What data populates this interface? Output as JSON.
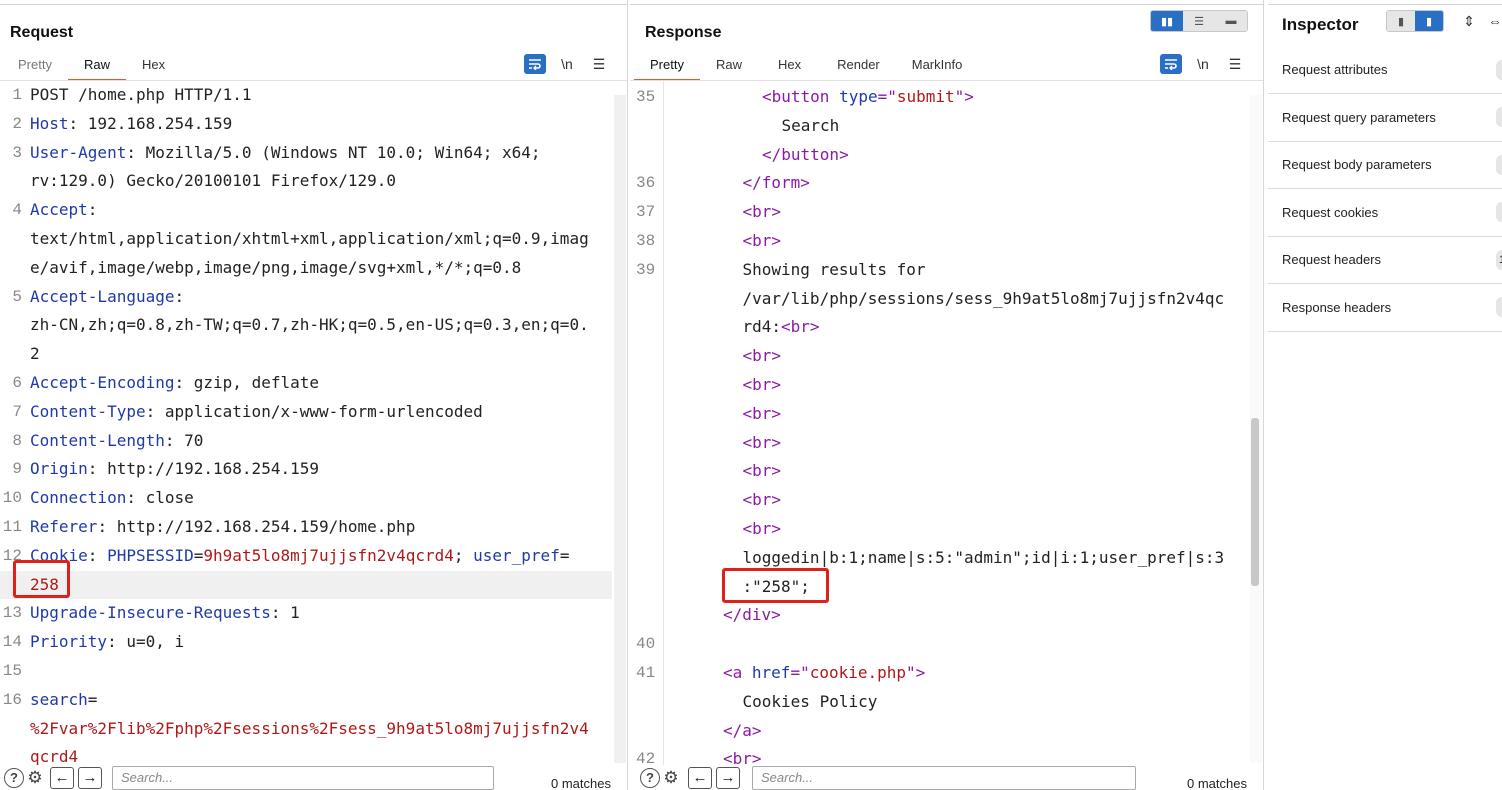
{
  "request": {
    "title": "Request",
    "tabs": [
      "Pretty",
      "Raw",
      "Hex"
    ],
    "active_tab": "Raw",
    "icons": [
      "wrap-lines-icon",
      "newline-toggle-icon",
      "menu-icon"
    ],
    "newline_label": "\\n",
    "lines": [
      {
        "n": "1",
        "segs": [
          [
            "p",
            "POST /home.php HTTP/1.1"
          ]
        ]
      },
      {
        "n": "2",
        "segs": [
          [
            "k",
            "Host"
          ],
          [
            "p",
            ": 192.168.254.159"
          ]
        ]
      },
      {
        "n": "3",
        "segs": [
          [
            "k",
            "User-Agent"
          ],
          [
            "p",
            ": Mozilla/5.0 (Windows NT 10.0; Win64; x64;"
          ]
        ]
      },
      {
        "n": "",
        "segs": [
          [
            "p",
            "rv:129.0) Gecko/20100101 Firefox/129.0"
          ]
        ]
      },
      {
        "n": "4",
        "segs": [
          [
            "k",
            "Accept"
          ],
          [
            "p",
            ":"
          ]
        ]
      },
      {
        "n": "",
        "segs": [
          [
            "p",
            "text/html,application/xhtml+xml,application/xml;q=0.9,imag"
          ]
        ]
      },
      {
        "n": "",
        "segs": [
          [
            "p",
            "e/avif,image/webp,image/png,image/svg+xml,*/*;q=0.8"
          ]
        ]
      },
      {
        "n": "5",
        "segs": [
          [
            "k",
            "Accept-Language"
          ],
          [
            "p",
            ":"
          ]
        ]
      },
      {
        "n": "",
        "segs": [
          [
            "p",
            "zh-CN,zh;q=0.8,zh-TW;q=0.7,zh-HK;q=0.5,en-US;q=0.3,en;q=0."
          ]
        ]
      },
      {
        "n": "",
        "segs": [
          [
            "p",
            "2"
          ]
        ]
      },
      {
        "n": "6",
        "segs": [
          [
            "k",
            "Accept-Encoding"
          ],
          [
            "p",
            ": gzip, deflate"
          ]
        ]
      },
      {
        "n": "7",
        "segs": [
          [
            "k",
            "Content-Type"
          ],
          [
            "p",
            ": application/x-www-form-urlencoded"
          ]
        ]
      },
      {
        "n": "8",
        "segs": [
          [
            "k",
            "Content-Length"
          ],
          [
            "p",
            ": 70"
          ]
        ]
      },
      {
        "n": "9",
        "segs": [
          [
            "k",
            "Origin"
          ],
          [
            "p",
            ": http://192.168.254.159"
          ]
        ]
      },
      {
        "n": "10",
        "segs": [
          [
            "k",
            "Connection"
          ],
          [
            "p",
            ": close"
          ]
        ]
      },
      {
        "n": "11",
        "segs": [
          [
            "k",
            "Referer"
          ],
          [
            "p",
            ": http://192.168.254.159/home.php"
          ]
        ]
      },
      {
        "n": "12",
        "segs": [
          [
            "k",
            "Cookie"
          ],
          [
            "p",
            ": "
          ],
          [
            "k",
            "PHPSESSID"
          ],
          [
            "p",
            "="
          ],
          [
            "v",
            "9h9at5lo8mj7ujjsfn2v4qcrd4"
          ],
          [
            "p",
            "; "
          ],
          [
            "k",
            "user_pref"
          ],
          [
            "p",
            "="
          ]
        ]
      },
      {
        "n": "",
        "segs": [
          [
            "v",
            "258"
          ]
        ],
        "hl": true
      },
      {
        "n": "13",
        "segs": [
          [
            "k",
            "Upgrade-Insecure-Requests"
          ],
          [
            "p",
            ": 1"
          ]
        ]
      },
      {
        "n": "14",
        "segs": [
          [
            "k",
            "Priority"
          ],
          [
            "p",
            ": u=0, i"
          ]
        ]
      },
      {
        "n": "15",
        "segs": []
      },
      {
        "n": "16",
        "segs": [
          [
            "k",
            "search"
          ],
          [
            "p",
            "="
          ]
        ]
      },
      {
        "n": "",
        "segs": [
          [
            "v",
            "%2Fvar%2Flib%2Fphp%2Fsessions%2Fsess_9h9at5lo8mj7ujjsfn2v4"
          ]
        ]
      },
      {
        "n": "",
        "segs": [
          [
            "v",
            "qcrd4"
          ]
        ]
      }
    ],
    "search_placeholder": "Search...",
    "matches": "0 matches"
  },
  "response": {
    "title": "Response",
    "tabs": [
      "Pretty",
      "Raw",
      "Hex",
      "Render",
      "MarkInfo"
    ],
    "active_tab": "Pretty",
    "icons": [
      "wrap-lines-icon",
      "newline-toggle-icon",
      "menu-icon"
    ],
    "newline_label": "\\n",
    "lines": [
      {
        "n": "35",
        "i": 6,
        "segs": [
          [
            "t",
            "<button "
          ],
          [
            "k",
            "type"
          ],
          [
            "t",
            "=\""
          ],
          [
            "v",
            "submit"
          ],
          [
            "t",
            "\">"
          ]
        ]
      },
      {
        "n": "",
        "i": 7,
        "segs": [
          [
            "p",
            "Search"
          ]
        ]
      },
      {
        "n": "",
        "i": 6,
        "segs": [
          [
            "t",
            "</button>"
          ]
        ]
      },
      {
        "n": "36",
        "i": 5,
        "segs": [
          [
            "t",
            "</form>"
          ]
        ]
      },
      {
        "n": "37",
        "i": 5,
        "segs": [
          [
            "t",
            "<br>"
          ]
        ]
      },
      {
        "n": "38",
        "i": 5,
        "segs": [
          [
            "t",
            "<br>"
          ]
        ]
      },
      {
        "n": "39",
        "i": 5,
        "segs": [
          [
            "p",
            "Showing results for"
          ]
        ]
      },
      {
        "n": "",
        "i": 5,
        "segs": [
          [
            "p",
            "/var/lib/php/sessions/sess_9h9at5lo8mj7ujjsfn2v4qc"
          ]
        ]
      },
      {
        "n": "",
        "i": 5,
        "segs": [
          [
            "p",
            "rd4:"
          ],
          [
            "t",
            "<br>"
          ]
        ]
      },
      {
        "n": "",
        "i": 5,
        "segs": [
          [
            "t",
            "<br>"
          ]
        ]
      },
      {
        "n": "",
        "i": 5,
        "segs": [
          [
            "t",
            "<br>"
          ]
        ]
      },
      {
        "n": "",
        "i": 5,
        "segs": [
          [
            "t",
            "<br>"
          ]
        ]
      },
      {
        "n": "",
        "i": 5,
        "segs": [
          [
            "t",
            "<br>"
          ]
        ]
      },
      {
        "n": "",
        "i": 5,
        "segs": [
          [
            "t",
            "<br>"
          ]
        ]
      },
      {
        "n": "",
        "i": 5,
        "segs": [
          [
            "t",
            "<br>"
          ]
        ]
      },
      {
        "n": "",
        "i": 5,
        "segs": [
          [
            "t",
            "<br>"
          ]
        ]
      },
      {
        "n": "",
        "i": 5,
        "segs": [
          [
            "p",
            "loggedin|b:1;name|s:5:\"admin\";id|i:1;user_pref|s:3"
          ]
        ]
      },
      {
        "n": "",
        "i": 5,
        "segs": [
          [
            "p",
            ":\"258\";"
          ]
        ]
      },
      {
        "n": "",
        "i": 4,
        "segs": [
          [
            "t",
            "</div>"
          ]
        ]
      },
      {
        "n": "40",
        "i": 4,
        "segs": []
      },
      {
        "n": "41",
        "i": 4,
        "segs": [
          [
            "t",
            "<a "
          ],
          [
            "k",
            "href"
          ],
          [
            "t",
            "=\""
          ],
          [
            "v",
            "cookie.php"
          ],
          [
            "t",
            "\">"
          ]
        ]
      },
      {
        "n": "",
        "i": 5,
        "segs": [
          [
            "p",
            "Cookies Policy"
          ]
        ]
      },
      {
        "n": "",
        "i": 4,
        "segs": [
          [
            "t",
            "</a>"
          ]
        ]
      },
      {
        "n": "42",
        "i": 4,
        "segs": [
          [
            "t",
            "<br>"
          ]
        ]
      }
    ],
    "search_placeholder": "Search...",
    "matches": "0 matches"
  },
  "inspector": {
    "title": "Inspector",
    "sections": [
      "Request attributes",
      "Request query parameters",
      "Request body parameters",
      "Request cookies",
      "Request headers",
      "Response headers"
    ],
    "header_count": "1"
  },
  "colors": {
    "key": "#1f3aa8",
    "value": "#b01818",
    "tag": "#8a1aa5",
    "accent": "#2a6fc6",
    "tab_underline": "#e8572a",
    "highlight_box": "#e0201b"
  }
}
